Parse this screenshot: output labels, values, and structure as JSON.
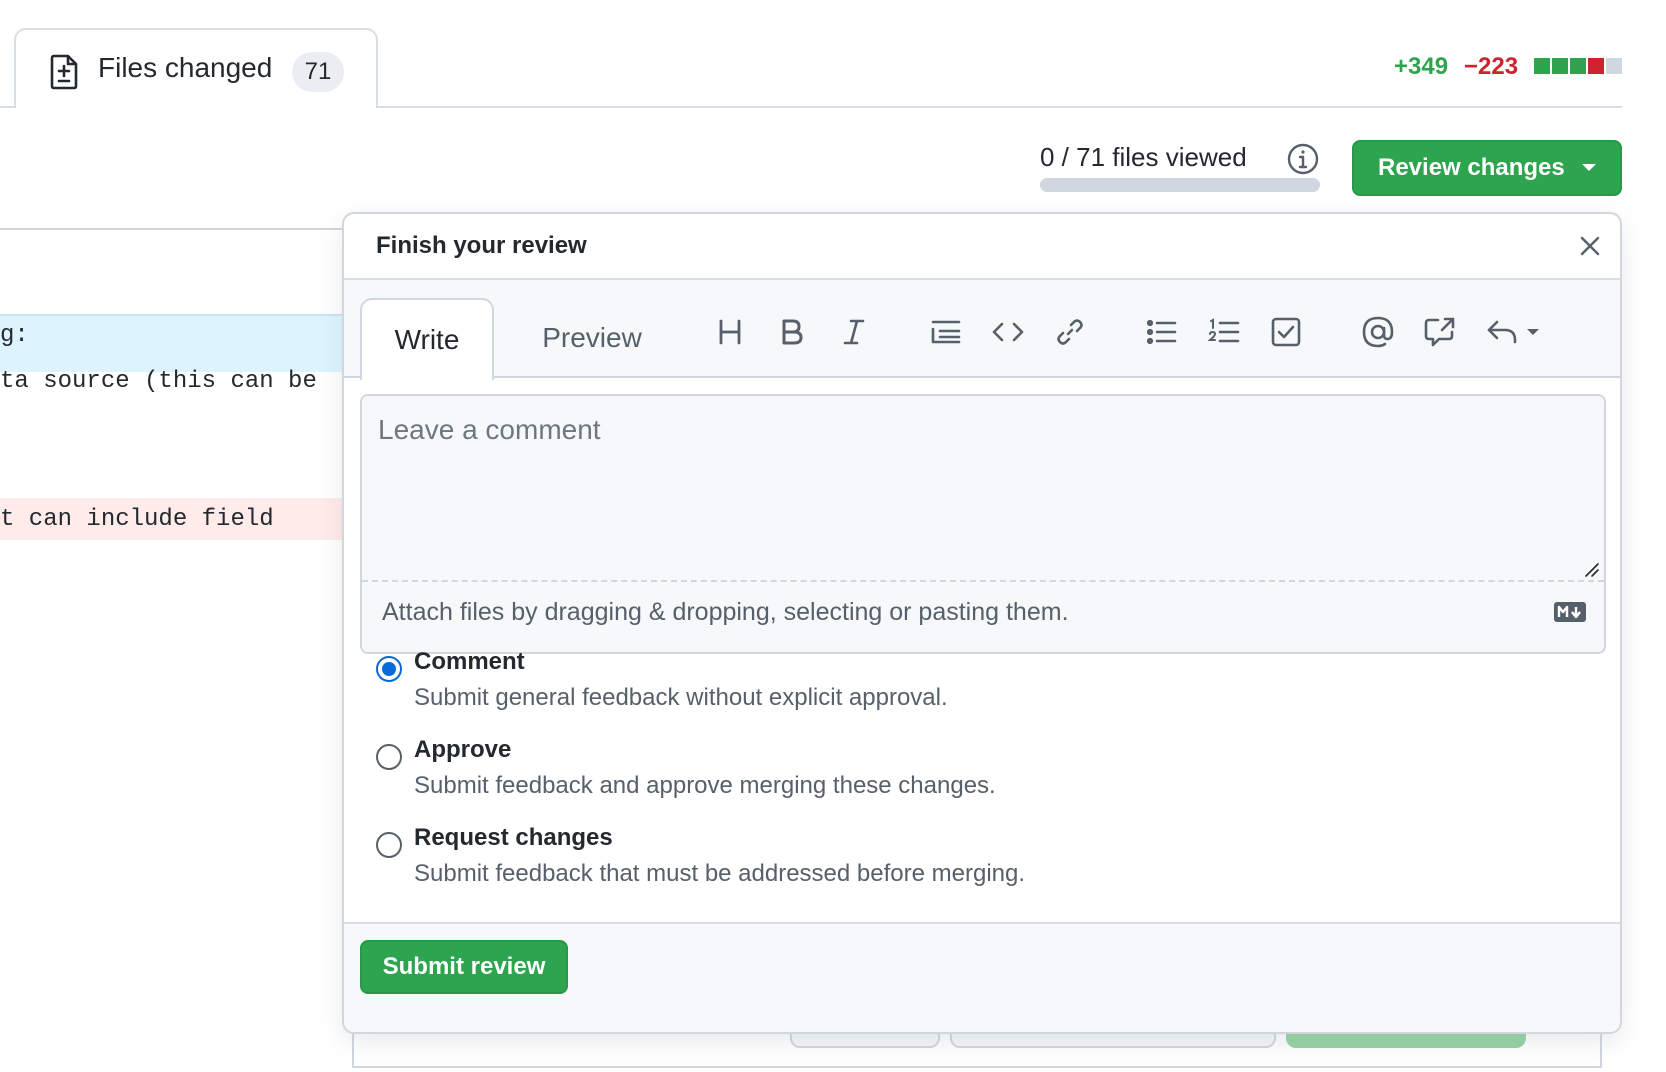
{
  "tabs": {
    "files_changed": {
      "label": "Files changed",
      "count": "71"
    }
  },
  "diffstat": {
    "additions": "+349",
    "deletions": "−223",
    "blocks": [
      "#2da44e",
      "#2da44e",
      "#2da44e",
      "#cf222e",
      "#d0d7de"
    ]
  },
  "files_viewed": {
    "label": "0 / 71 files viewed",
    "viewed": 0,
    "total": 71
  },
  "review_button": {
    "label": "Review changes",
    "color": "#2da44e"
  },
  "background_code": {
    "line_1": "g:",
    "line_2": "ta source (this can be",
    "line_3": "t can include field"
  },
  "review_panel": {
    "title": "Finish your review",
    "editor_tabs": {
      "write": "Write",
      "preview": "Preview"
    },
    "toolbar": [
      "heading-icon",
      "bold-icon",
      "italic-icon",
      "quote-icon",
      "code-icon",
      "link-icon",
      "unordered-list-icon",
      "ordered-list-icon",
      "task-list-icon",
      "mention-icon",
      "cross-reference-icon",
      "reply-icon"
    ],
    "comment": {
      "placeholder": "Leave a comment",
      "value": ""
    },
    "attach_hint": "Attach files by dragging & dropping, selecting or pasting them.",
    "options": [
      {
        "title": "Comment",
        "description": "Submit general feedback without explicit approval.",
        "checked": true
      },
      {
        "title": "Approve",
        "description": "Submit feedback and approve merging these changes.",
        "checked": false
      },
      {
        "title": "Request changes",
        "description": "Submit feedback that must be addressed before merging.",
        "checked": false
      }
    ],
    "submit_label": "Submit review"
  },
  "colors": {
    "accent_green": "#2da44e",
    "accent_red": "#cf222e",
    "link_blue": "#0969da"
  }
}
